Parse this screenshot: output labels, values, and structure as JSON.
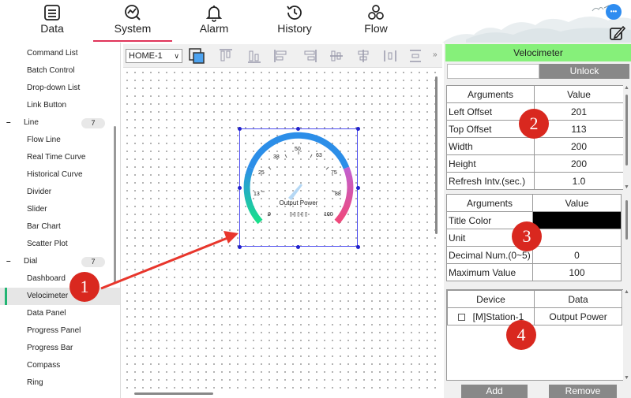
{
  "nav": {
    "tabs": [
      {
        "label": "Data",
        "icon": "data-list-icon"
      },
      {
        "label": "System",
        "icon": "system-chart-icon"
      },
      {
        "label": "Alarm",
        "icon": "bell-icon"
      },
      {
        "label": "History",
        "icon": "history-clock-icon"
      },
      {
        "label": "Flow",
        "icon": "flow-icon"
      }
    ],
    "active": "System",
    "more_label": "•••"
  },
  "sidebar": {
    "items_before": [
      "Command List",
      "Batch Control",
      "Drop-down List",
      "Link Button"
    ],
    "group_line": {
      "label": "Line",
      "count": "7"
    },
    "line_items": [
      "Flow Line",
      "Real Time Curve",
      "Historical Curve",
      "Divider",
      "Slider",
      "Bar Chart",
      "Scatter Plot"
    ],
    "group_dial": {
      "label": "Dial",
      "count": "7"
    },
    "dial_items": [
      "Dashboard",
      "Velocimeter",
      "Data Panel",
      "Progress Panel",
      "Progress Bar",
      "Compass",
      "Ring"
    ],
    "active_item": "Velocimeter"
  },
  "toolbar": {
    "page": "HOME-1",
    "overflow": "»"
  },
  "gauge": {
    "ticks": [
      "0",
      "13",
      "25",
      "38",
      "50",
      "63",
      "75",
      "88",
      "100"
    ],
    "label": "Output Power",
    "display": "▯▯▯▯▯",
    "colors": {
      "start": "#18e08a",
      "middle": "#2c8ee8",
      "end": "#f0487a",
      "needle": "#b5d8f5"
    }
  },
  "props": {
    "title": "Velocimeter",
    "name_value": "",
    "unlock_label": "Unlock",
    "table1": {
      "header": [
        "Arguments",
        "Value"
      ],
      "rows": [
        [
          "Left Offset",
          "201"
        ],
        [
          "Top Offset",
          "113"
        ],
        [
          "Width",
          "200"
        ],
        [
          "Height",
          "200"
        ],
        [
          "Refresh Intv.(sec.)",
          "1.0"
        ]
      ]
    },
    "table2": {
      "header": [
        "Arguments",
        "Value"
      ],
      "rows": [
        [
          "Title Color",
          ""
        ],
        [
          "Unit",
          ""
        ],
        [
          "Decimal Num.(0~5)",
          "0"
        ],
        [
          "Maximum Value",
          "100"
        ]
      ],
      "title_color": "#000000"
    },
    "devices": {
      "header": [
        "Device",
        "Data"
      ],
      "rows": [
        [
          "[M]Station-1",
          "Output Power"
        ]
      ]
    },
    "add_label": "Add",
    "remove_label": "Remove"
  },
  "annotations": {
    "badges": [
      "1",
      "2",
      "3",
      "4"
    ],
    "color": "#d9281f"
  }
}
